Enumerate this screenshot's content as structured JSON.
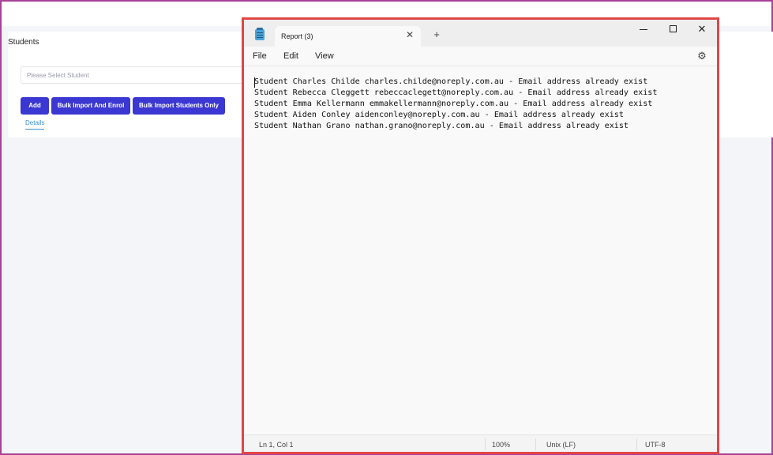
{
  "app": {
    "section_title": "Students",
    "student_select_placeholder": "Please Select Student",
    "buttons": {
      "add": "Add",
      "bulk_import_enrol": "Bulk Import And Enrol",
      "bulk_import_only": "Bulk Import Students Only"
    },
    "tabs": {
      "details": "Details"
    },
    "colors": {
      "primary_button": "#3b37d2",
      "tab_active": "#3a8fd6",
      "frame_border": "#a8409a"
    }
  },
  "notepad": {
    "tab_title": "Report (3)",
    "menu": {
      "file": "File",
      "edit": "Edit",
      "view": "View"
    },
    "lines": [
      "Student Charles Childe charles.childe@noreply.com.au - Email address already exist",
      "Student Rebecca Cleggett rebeccaclegett@noreply.com.au - Email address already exist",
      "Student Emma Kellermann emmakellermann@noreply.com.au - Email address already exist",
      "Student Aiden Conley aidenconley@noreply.com.au - Email address already exist",
      "Student Nathan Grano nathan.grano@noreply.com.au - Email address already exist"
    ],
    "status": {
      "position": "Ln 1, Col 1",
      "zoom": "100%",
      "line_ending": "Unix (LF)",
      "encoding": "UTF-8"
    },
    "icons": {
      "app": "notepad-icon",
      "close_tab": "close-icon",
      "new_tab": "plus-icon",
      "settings": "gear-icon"
    },
    "colors": {
      "window_border": "#e04646"
    }
  }
}
